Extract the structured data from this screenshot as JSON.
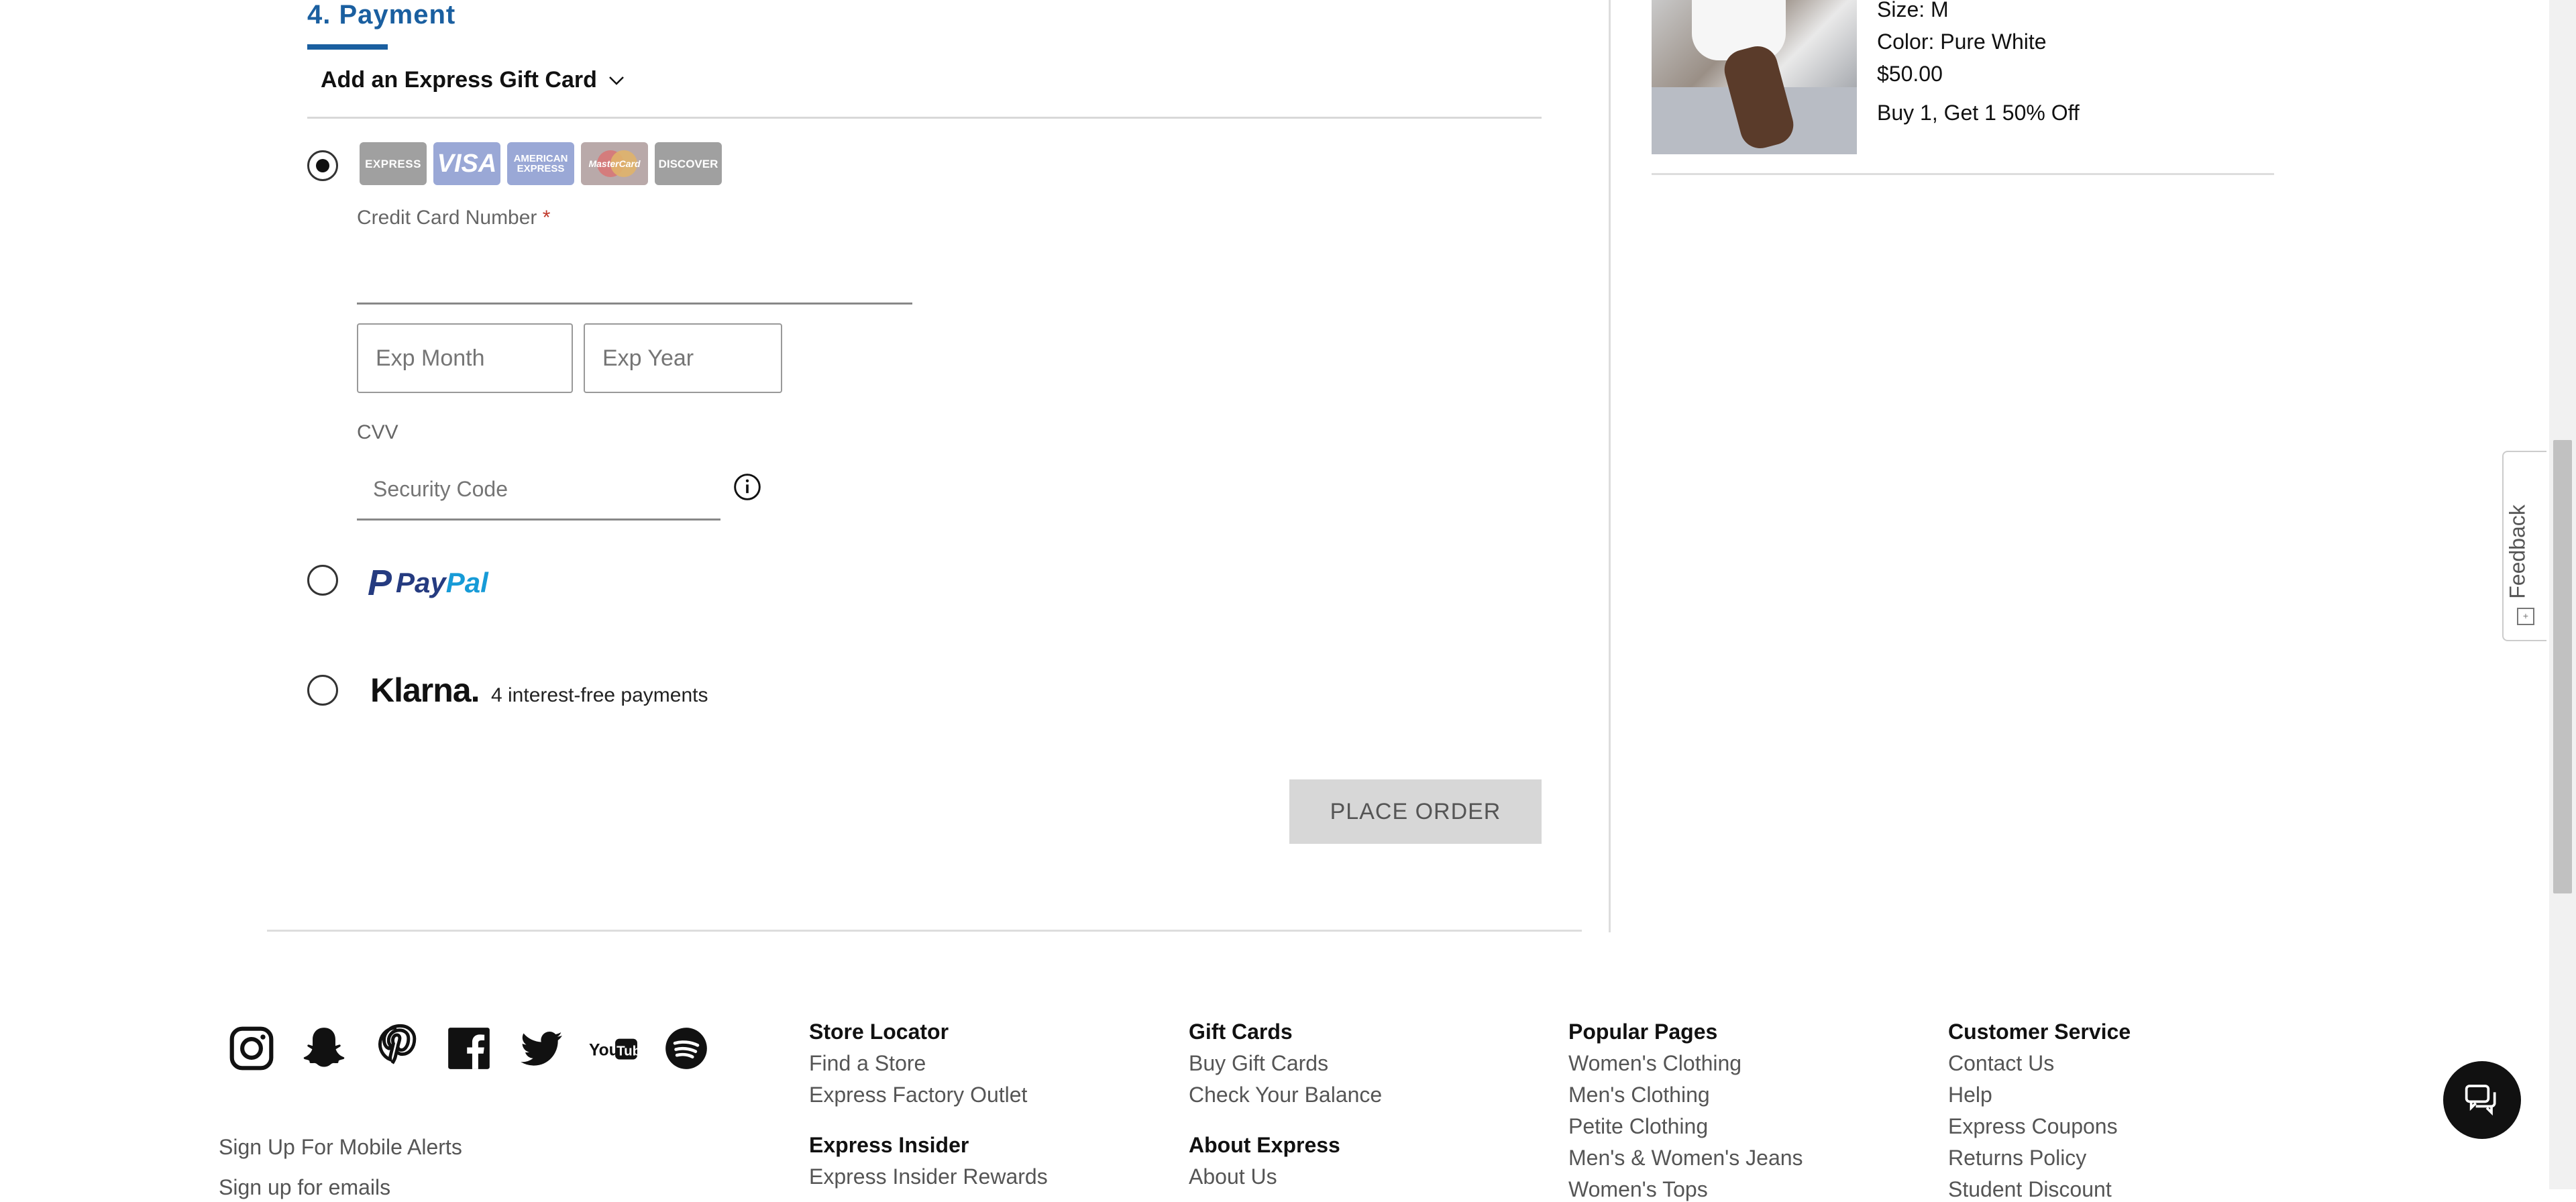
{
  "payment": {
    "section_title": "4. Payment",
    "gift_card_toggle": "Add an Express Gift Card",
    "card_logos": [
      "EXPRESS",
      "VISA",
      "AMERICAN EXPRESS",
      "MasterCard",
      "DISCOVER"
    ],
    "cc_label": "Credit Card Number",
    "required_mark": "*",
    "cc_value": "",
    "exp_month_placeholder": "Exp Month",
    "exp_year_placeholder": "Exp Year",
    "cvv_label": "CVV",
    "cvv_placeholder": "Security Code",
    "paypal_logo": {
      "p": "P",
      "pay": "Pay",
      "pal": "Pal"
    },
    "klarna_logo": "Klarna.",
    "klarna_sub": "4 interest-free payments",
    "place_order": "PLACE ORDER",
    "selected_method": "credit_card"
  },
  "summary": {
    "size": "Size: M",
    "color": "Color: Pure White",
    "price": "$50.00",
    "promo": "Buy 1, Get 1 50% Off"
  },
  "feedback_tab": "Feedback",
  "footer": {
    "social_icons": [
      "instagram-icon",
      "snapchat-icon",
      "pinterest-icon",
      "facebook-icon",
      "twitter-icon",
      "youtube-icon",
      "spotify-icon"
    ],
    "mobile_alerts": "Sign Up For Mobile Alerts",
    "mobile_alerts_2": "Sign up for emails",
    "columns": [
      {
        "groups": [
          {
            "heading": "Store Locator",
            "links": [
              "Find a Store",
              "Express Factory Outlet"
            ]
          },
          {
            "heading": "Express Insider",
            "links": [
              "Express Insider Rewards"
            ]
          }
        ]
      },
      {
        "groups": [
          {
            "heading": "Gift Cards",
            "links": [
              "Buy Gift Cards",
              "Check Your Balance"
            ]
          },
          {
            "heading": "About Express",
            "links": [
              "About Us"
            ]
          }
        ]
      },
      {
        "groups": [
          {
            "heading": "Popular Pages",
            "links": [
              "Women's Clothing",
              "Men's Clothing",
              "Petite Clothing",
              "Men's & Women's Jeans",
              "Women's Tops"
            ]
          }
        ]
      },
      {
        "groups": [
          {
            "heading": "Customer Service",
            "links": [
              "Contact Us",
              "Help",
              "Express Coupons",
              "Returns Policy",
              "Student Discount"
            ]
          }
        ]
      }
    ]
  },
  "colors": {
    "accent": "#1a5fa0",
    "button_bg": "#d7d7d7",
    "chat": "#111111"
  }
}
